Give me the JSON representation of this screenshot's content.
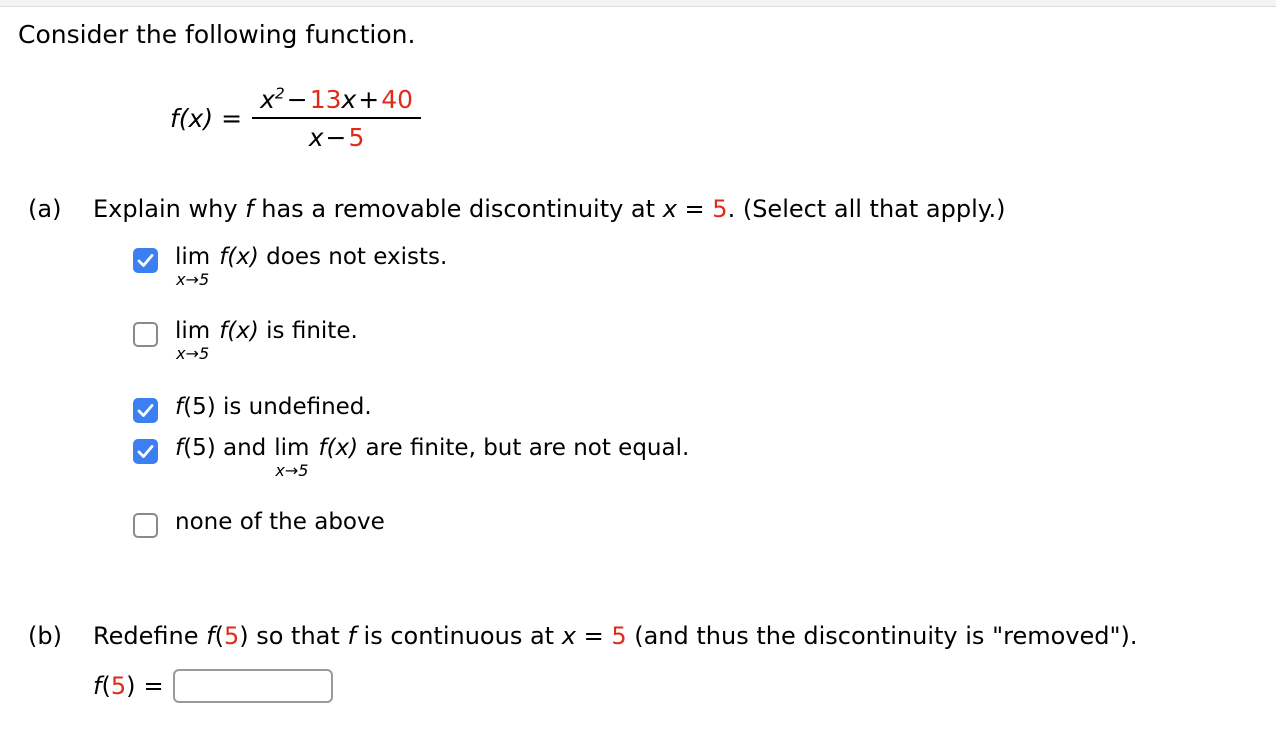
{
  "document": {
    "intro": "Consider the following function.",
    "formula": {
      "lhs": "f(x)",
      "equals": "=",
      "numerator": {
        "base": "x",
        "exponent": "2",
        "minus": "−",
        "coefficient": "13",
        "variable": "x",
        "plus": "+",
        "constant": "40"
      },
      "denominator": {
        "variable": "x",
        "minus": "−",
        "constant": "5"
      }
    }
  },
  "parts": {
    "a": {
      "label": "(a)",
      "prompt_before": "Explain why",
      "prompt_f": "f",
      "prompt_mid": "has a removable discontinuity at",
      "prompt_x": "x",
      "prompt_eq": "=",
      "prompt_value": "5",
      "prompt_after": ". (Select all that apply.)",
      "options": [
        {
          "id": "limit-dne",
          "checked": true,
          "kind": "limit",
          "lim_op": "lim",
          "lim_sub": "x→5",
          "text_f": "f(x)",
          "text_after": "does not exists."
        },
        {
          "id": "limit-finite",
          "checked": false,
          "kind": "limit",
          "lim_op": "lim",
          "lim_sub": "x→5",
          "text_f": "f(x)",
          "text_after": "is finite."
        },
        {
          "id": "f5-undefined",
          "checked": true,
          "kind": "plain",
          "text_f": "f",
          "text_after": "(5) is undefined."
        },
        {
          "id": "f5-and-limit-not-equal",
          "checked": true,
          "kind": "mixed",
          "text_f": "f",
          "text_before": "(5) and",
          "lim_op": "lim",
          "lim_sub": "x→5",
          "text_f2": "f(x)",
          "text_after": "are finite, but are not equal."
        },
        {
          "id": "none-of-the-above",
          "checked": false,
          "kind": "plain",
          "text_f": "",
          "text_after": "none of the above"
        }
      ]
    },
    "b": {
      "label": "(b)",
      "prompt_before": "Redefine",
      "prompt_f": "f",
      "prompt_paren_open": "(",
      "prompt_value": "5",
      "prompt_paren_close": ")",
      "prompt_mid": "so that",
      "prompt_f2": "f",
      "prompt_mid2": "is continuous at",
      "prompt_x": "x",
      "prompt_eq": "=",
      "prompt_value2": "5",
      "prompt_after": "(and thus the discontinuity is \"removed\").",
      "answer_label_f": "f",
      "answer_label_open": "(",
      "answer_label_value": "5",
      "answer_label_close": ")",
      "answer_equals": "=",
      "answer_value": "",
      "answer_placeholder": ""
    }
  },
  "colors": {
    "accent_red": "#dd2c1a",
    "checkbox_blue": "#3b7ff0",
    "border_gray": "#9a9a9a"
  }
}
